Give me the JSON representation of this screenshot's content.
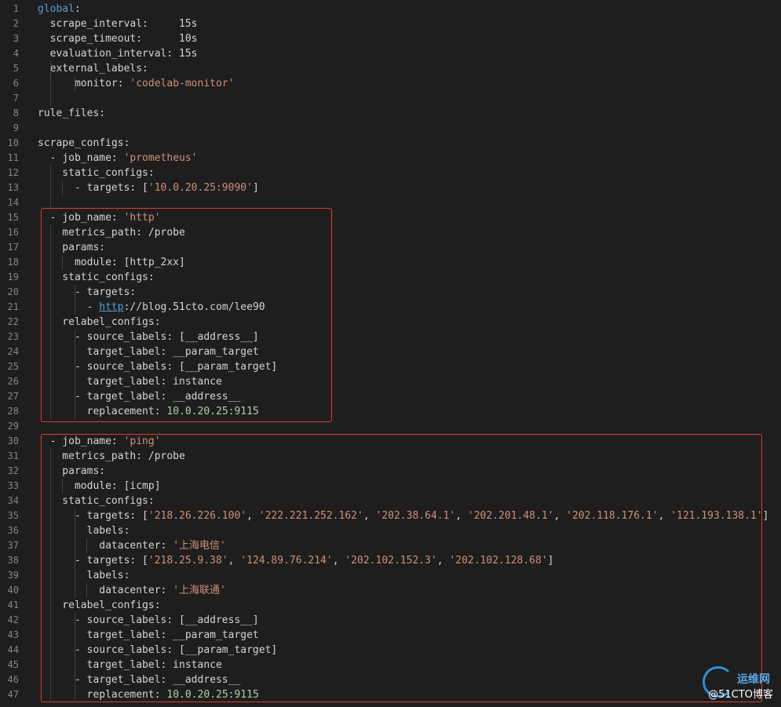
{
  "editor": {
    "lines": [
      {
        "n": "1",
        "tokens": [
          {
            "t": "global",
            "c": "kg"
          },
          {
            "t": ":",
            "c": "p"
          }
        ]
      },
      {
        "n": "2",
        "tokens": [
          {
            "t": "  scrape_interval:     ",
            "c": "k"
          },
          {
            "t": "15s",
            "c": "k"
          }
        ]
      },
      {
        "n": "3",
        "tokens": [
          {
            "t": "  scrape_timeout:      ",
            "c": "k"
          },
          {
            "t": "10s",
            "c": "k"
          }
        ]
      },
      {
        "n": "4",
        "tokens": [
          {
            "t": "  evaluation_interval: ",
            "c": "k"
          },
          {
            "t": "15s",
            "c": "k"
          }
        ]
      },
      {
        "n": "5",
        "tokens": [
          {
            "t": "  external_labels:",
            "c": "k"
          }
        ]
      },
      {
        "n": "6",
        "tokens": [
          {
            "t": "      monitor: ",
            "c": "k"
          },
          {
            "t": "'codelab-monitor'",
            "c": "s"
          }
        ]
      },
      {
        "n": "7",
        "tokens": []
      },
      {
        "n": "8",
        "tokens": [
          {
            "t": "rule_files:",
            "c": "k"
          }
        ]
      },
      {
        "n": "9",
        "tokens": []
      },
      {
        "n": "10",
        "tokens": [
          {
            "t": "scrape_configs:",
            "c": "k"
          }
        ]
      },
      {
        "n": "11",
        "tokens": [
          {
            "t": "  - job_name: ",
            "c": "k"
          },
          {
            "t": "'prometheus'",
            "c": "s"
          }
        ]
      },
      {
        "n": "12",
        "tokens": [
          {
            "t": "    static_configs:",
            "c": "k"
          }
        ]
      },
      {
        "n": "13",
        "tokens": [
          {
            "t": "      - targets: [",
            "c": "k"
          },
          {
            "t": "'10.0.20.25:9090'",
            "c": "s"
          },
          {
            "t": "]",
            "c": "k"
          }
        ]
      },
      {
        "n": "14",
        "tokens": []
      },
      {
        "n": "15",
        "tokens": [
          {
            "t": "  - job_name: ",
            "c": "k"
          },
          {
            "t": "'http'",
            "c": "s"
          }
        ]
      },
      {
        "n": "16",
        "tokens": [
          {
            "t": "    metrics_path: /probe",
            "c": "k"
          }
        ]
      },
      {
        "n": "17",
        "tokens": [
          {
            "t": "    params:",
            "c": "k"
          }
        ]
      },
      {
        "n": "18",
        "tokens": [
          {
            "t": "      module: [http_2xx]",
            "c": "k"
          }
        ]
      },
      {
        "n": "19",
        "tokens": [
          {
            "t": "    static_configs:",
            "c": "k"
          }
        ]
      },
      {
        "n": "20",
        "tokens": [
          {
            "t": "      - targets:",
            "c": "k"
          }
        ]
      },
      {
        "n": "21",
        "tokens": [
          {
            "t": "        - ",
            "c": "k"
          },
          {
            "t": "http",
            "c": "url"
          },
          {
            "t": "://blog.51cto.com/lee90",
            "c": "k"
          }
        ]
      },
      {
        "n": "22",
        "tokens": [
          {
            "t": "    relabel_configs:",
            "c": "k"
          }
        ]
      },
      {
        "n": "23",
        "tokens": [
          {
            "t": "      - source_labels: [__address__]",
            "c": "k"
          }
        ]
      },
      {
        "n": "24",
        "tokens": [
          {
            "t": "        target_label: __param_target",
            "c": "k"
          }
        ]
      },
      {
        "n": "25",
        "tokens": [
          {
            "t": "      - source_labels: [__param_target]",
            "c": "k"
          }
        ]
      },
      {
        "n": "26",
        "tokens": [
          {
            "t": "        target_label: instance",
            "c": "k"
          }
        ]
      },
      {
        "n": "27",
        "tokens": [
          {
            "t": "      - target_label: __address__",
            "c": "k"
          }
        ]
      },
      {
        "n": "28",
        "tokens": [
          {
            "t": "        replacement: ",
            "c": "k"
          },
          {
            "t": "10.0.20.25:9115",
            "c": "n"
          }
        ]
      },
      {
        "n": "29",
        "tokens": []
      },
      {
        "n": "30",
        "tokens": [
          {
            "t": "  - job_name: ",
            "c": "k"
          },
          {
            "t": "'ping'",
            "c": "s"
          }
        ]
      },
      {
        "n": "31",
        "tokens": [
          {
            "t": "    metrics_path: /probe",
            "c": "k"
          }
        ]
      },
      {
        "n": "32",
        "tokens": [
          {
            "t": "    params:",
            "c": "k"
          }
        ]
      },
      {
        "n": "33",
        "tokens": [
          {
            "t": "      module: [icmp]",
            "c": "k"
          }
        ]
      },
      {
        "n": "34",
        "tokens": [
          {
            "t": "    static_configs:",
            "c": "k"
          }
        ]
      },
      {
        "n": "35",
        "tokens": [
          {
            "t": "      - targets: [",
            "c": "k"
          },
          {
            "t": "'218.26.226.100'",
            "c": "s"
          },
          {
            "t": ", ",
            "c": "k"
          },
          {
            "t": "'222.221.252.162'",
            "c": "s"
          },
          {
            "t": ", ",
            "c": "k"
          },
          {
            "t": "'202.38.64.1'",
            "c": "s"
          },
          {
            "t": ", ",
            "c": "k"
          },
          {
            "t": "'202.201.48.1'",
            "c": "s"
          },
          {
            "t": ", ",
            "c": "k"
          },
          {
            "t": "'202.118.176.1'",
            "c": "s"
          },
          {
            "t": ", ",
            "c": "k"
          },
          {
            "t": "'121.193.138.1'",
            "c": "s"
          },
          {
            "t": "]",
            "c": "k"
          }
        ]
      },
      {
        "n": "36",
        "tokens": [
          {
            "t": "        labels:",
            "c": "k"
          }
        ]
      },
      {
        "n": "37",
        "tokens": [
          {
            "t": "          datacenter: ",
            "c": "k"
          },
          {
            "t": "'上海电信'",
            "c": "s"
          }
        ]
      },
      {
        "n": "38",
        "tokens": [
          {
            "t": "      - targets: [",
            "c": "k"
          },
          {
            "t": "'218.25.9.38'",
            "c": "s"
          },
          {
            "t": ", ",
            "c": "k"
          },
          {
            "t": "'124.89.76.214'",
            "c": "s"
          },
          {
            "t": ", ",
            "c": "k"
          },
          {
            "t": "'202.102.152.3'",
            "c": "s"
          },
          {
            "t": ", ",
            "c": "k"
          },
          {
            "t": "'202.102.128.68'",
            "c": "s"
          },
          {
            "t": "]",
            "c": "k"
          }
        ]
      },
      {
        "n": "39",
        "tokens": [
          {
            "t": "        labels:",
            "c": "k"
          }
        ]
      },
      {
        "n": "40",
        "tokens": [
          {
            "t": "          datacenter: ",
            "c": "k"
          },
          {
            "t": "'上海联通'",
            "c": "s"
          }
        ]
      },
      {
        "n": "41",
        "tokens": [
          {
            "t": "    relabel_configs:",
            "c": "k"
          }
        ]
      },
      {
        "n": "42",
        "tokens": [
          {
            "t": "      - source_labels: [__address__]",
            "c": "k"
          }
        ]
      },
      {
        "n": "43",
        "tokens": [
          {
            "t": "        target_label: __param_target",
            "c": "k"
          }
        ]
      },
      {
        "n": "44",
        "tokens": [
          {
            "t": "      - source_labels: [__param_target]",
            "c": "k"
          }
        ]
      },
      {
        "n": "45",
        "tokens": [
          {
            "t": "        target_label: instance",
            "c": "k"
          }
        ]
      },
      {
        "n": "46",
        "tokens": [
          {
            "t": "      - target_label: __address__",
            "c": "k"
          }
        ]
      },
      {
        "n": "47",
        "tokens": [
          {
            "t": "        replacement: ",
            "c": "k"
          },
          {
            "t": "10.0.20.25:9115",
            "c": "n"
          }
        ]
      }
    ]
  },
  "watermark": {
    "site": "运维网",
    "brand": "@51CTO博客"
  },
  "colors": {
    "background": "#1e1e1e",
    "highlight_box": "#e03c31",
    "string": "#ce9178",
    "number": "#b5cea8",
    "keyword": "#569cd6"
  }
}
